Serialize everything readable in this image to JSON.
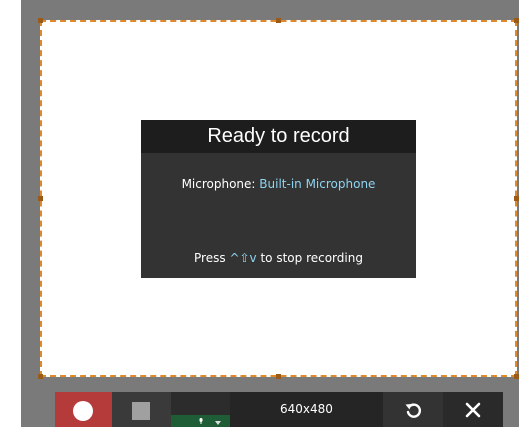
{
  "status_panel": {
    "title": "Ready to record",
    "microphone_label": "Microphone: ",
    "microphone_value": "Built-in Microphone",
    "shortcut_prefix": "Press ",
    "shortcut_keys": "^⇧v",
    "shortcut_suffix": " to stop recording"
  },
  "toolbar": {
    "size_label": "640x480",
    "icons": {
      "record": "record-icon",
      "stop": "stop-icon",
      "microphone": "microphone-icon",
      "dropdown": "chevron-down-icon",
      "undo": "undo-icon",
      "close": "close-icon"
    }
  },
  "colors": {
    "selection_border": "#e0892b",
    "record_button": "#b53a3a",
    "accent_text": "#8ed3f0",
    "audio_active": "#1f5d36"
  }
}
